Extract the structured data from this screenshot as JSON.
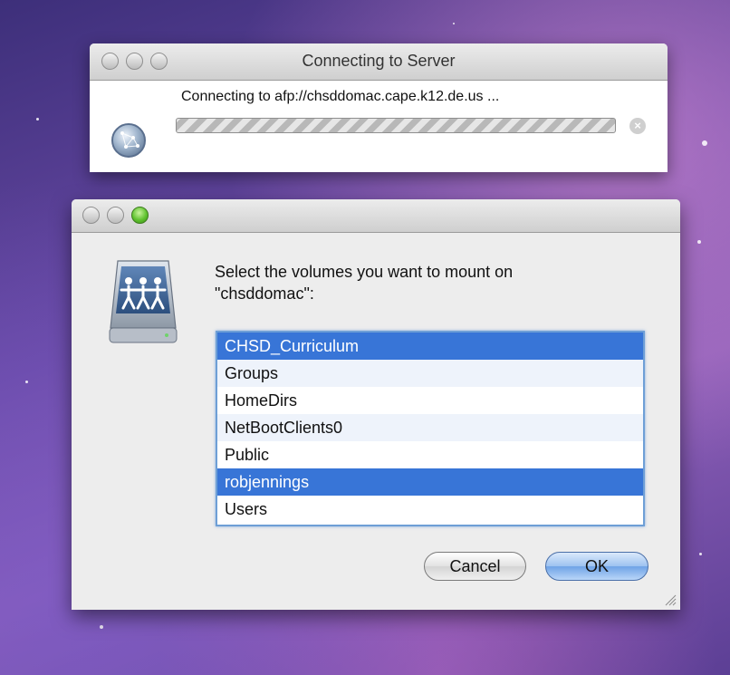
{
  "connecting_window": {
    "title": "Connecting to Server",
    "message": "Connecting to afp://chsddomac.cape.k12.de.us ...",
    "icon": "globe-icon"
  },
  "mount_dialog": {
    "prompt": "Select the volumes you want to mount on \"chsddomac\":",
    "icon": "shared-drive-icon",
    "volumes": [
      {
        "label": "CHSD_Curriculum",
        "selected": true
      },
      {
        "label": "Groups",
        "selected": false
      },
      {
        "label": "HomeDirs",
        "selected": false
      },
      {
        "label": "NetBootClients0",
        "selected": false
      },
      {
        "label": "Public",
        "selected": false
      },
      {
        "label": "robjennings",
        "selected": true
      },
      {
        "label": "Users",
        "selected": false
      }
    ],
    "cancel_label": "Cancel",
    "ok_label": "OK"
  },
  "colors": {
    "selection": "#3875d7",
    "accent_button": "#6fa3e6"
  }
}
